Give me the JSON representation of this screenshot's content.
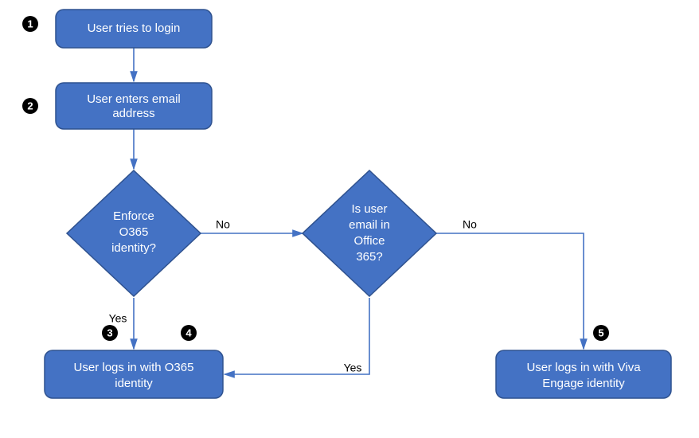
{
  "colors": {
    "node_fill": "#4472C4",
    "node_stroke": "#2F528F",
    "badge_fill": "#000000",
    "arrow": "#4472C4"
  },
  "nodes": {
    "n1": {
      "line1": "User tries to login"
    },
    "n2": {
      "line1": "User enters email",
      "line2": "address"
    },
    "d1": {
      "line1": "Enforce",
      "line2": "O365",
      "line3": "identity?"
    },
    "d2": {
      "line1": "Is user",
      "line2": "email in",
      "line3": "Office",
      "line4": "365?"
    },
    "n3": {
      "line1": "User logs in with O365",
      "line2": "identity"
    },
    "n4": {
      "line1": "User logs in with Viva",
      "line2": "Engage identity"
    }
  },
  "edges": {
    "d1_no": "No",
    "d1_yes": "Yes",
    "d2_no": "No",
    "d2_yes": "Yes"
  },
  "badges": {
    "b1": "1",
    "b2": "2",
    "b3": "3",
    "b4": "4",
    "b5": "5"
  }
}
